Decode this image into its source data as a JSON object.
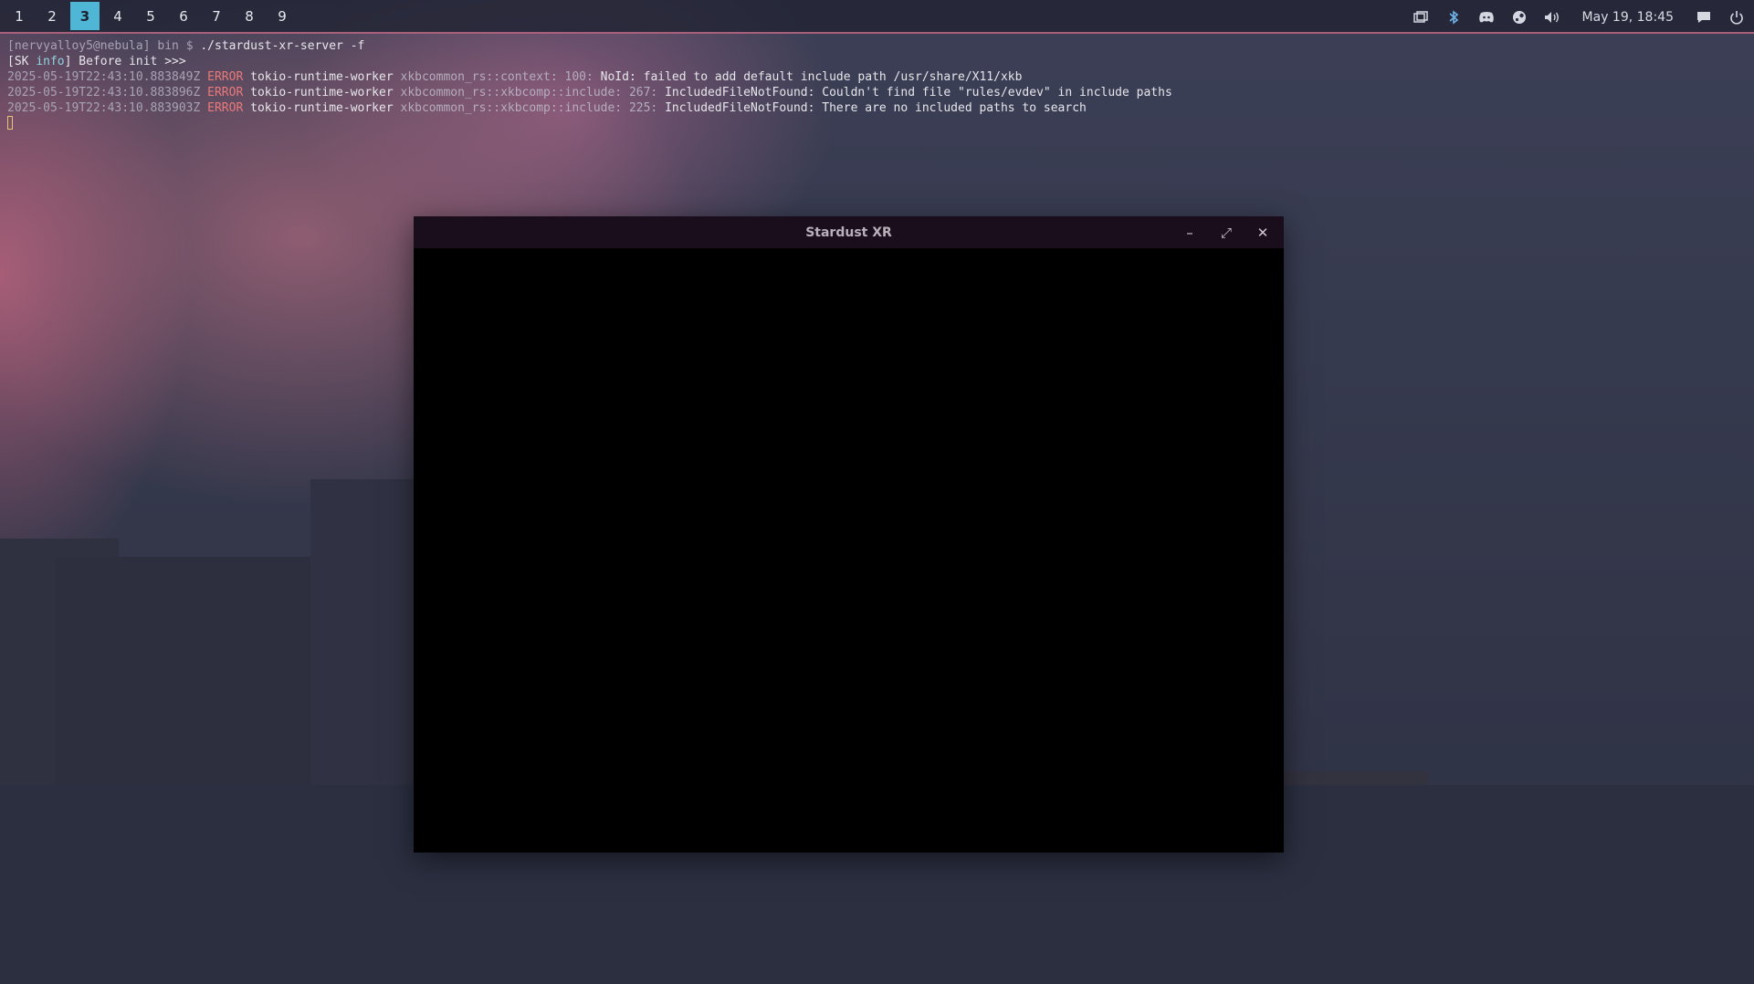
{
  "workspaces": [
    {
      "label": "1",
      "active": false
    },
    {
      "label": "2",
      "active": false
    },
    {
      "label": "3",
      "active": true
    },
    {
      "label": "4",
      "active": false
    },
    {
      "label": "5",
      "active": false
    },
    {
      "label": "6",
      "active": false
    },
    {
      "label": "7",
      "active": false
    },
    {
      "label": "8",
      "active": false
    },
    {
      "label": "9",
      "active": false
    }
  ],
  "tray": {
    "icons": [
      "window-switcher-icon",
      "bluetooth-icon",
      "discord-icon",
      "steam-icon",
      "volume-icon"
    ],
    "clock": "May 19, 18:45",
    "end_icons": [
      "notifications-icon",
      "power-icon"
    ]
  },
  "terminal": {
    "prompt": {
      "user_host": "[nervyalloy5@nebula]",
      "dir": "bin",
      "symbol": "$",
      "command": "./stardust-xr-server -f"
    },
    "info_line": {
      "open": "[SK ",
      "level": "info",
      "rest": "] Before init >>>"
    },
    "logs": [
      {
        "timestamp": "2025-05-19T22:43:10.883849Z",
        "level": "ERROR",
        "thread": "tokio-runtime-worker",
        "module": "xkbcommon_rs::context: 100:",
        "message": "NoId: failed to add default include path /usr/share/X11/xkb"
      },
      {
        "timestamp": "2025-05-19T22:43:10.883896Z",
        "level": "ERROR",
        "thread": "tokio-runtime-worker",
        "module": "xkbcommon_rs::xkbcomp::include: 267:",
        "message": "IncludedFileNotFound: Couldn't find file \"rules/evdev\" in include paths"
      },
      {
        "timestamp": "2025-05-19T22:43:10.883903Z",
        "level": "ERROR",
        "thread": "tokio-runtime-worker",
        "module": "xkbcommon_rs::xkbcomp::include: 225:",
        "message": "IncludedFileNotFound: There are no included paths to search"
      }
    ]
  },
  "window": {
    "title": "Stardust XR",
    "minimize": "–",
    "maximize": "⤢",
    "close": "✕"
  },
  "colors": {
    "accent": "#4fb6d6",
    "error": "#e87a7a",
    "titlebar": "#1a0d1c"
  }
}
